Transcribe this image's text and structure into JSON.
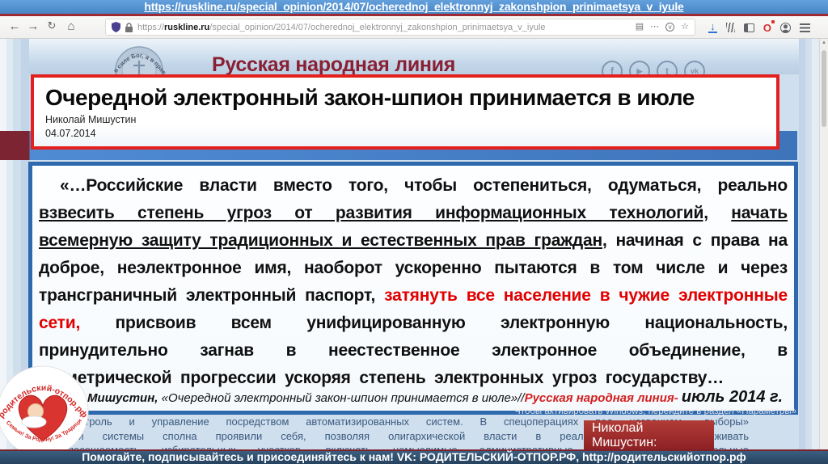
{
  "slide": {
    "source_url": "https://ruskline.ru/special_opinion/2014/07/ocherednoj_elektronnyj_zakonshpion_prinimaetsya_v_iyule"
  },
  "browser": {
    "left_icons": [
      {
        "name": "back-icon",
        "glyph": "←"
      },
      {
        "name": "forward-icon",
        "glyph": "→"
      },
      {
        "name": "reload-icon",
        "glyph": "↻"
      },
      {
        "name": "home-icon",
        "glyph": "⌂"
      }
    ],
    "address": {
      "scheme": "https://",
      "domain": "ruskline.ru",
      "path": "/special_opinion/2014/07/ocherednoj_elektronnyj_zakonshpion_prinimaetsya_v_iyule"
    },
    "urlbar_icons": [
      {
        "name": "reader-mode-icon",
        "glyph": "▤"
      },
      {
        "name": "page-actions-icon",
        "glyph": "⋯"
      },
      {
        "name": "pocket-icon",
        "glyph": "v"
      },
      {
        "name": "bookmark-star-icon",
        "glyph": "☆"
      }
    ],
    "right_icons": [
      {
        "name": "download-icon",
        "glyph": "↓"
      },
      {
        "name": "library-icon",
        "glyph": ""
      },
      {
        "name": "sidebar-icon",
        "glyph": ""
      },
      {
        "name": "adblock-icon",
        "glyph": "O"
      },
      {
        "name": "account-icon",
        "glyph": ""
      },
      {
        "name": "menu-icon",
        "glyph": ""
      }
    ]
  },
  "site": {
    "title": "Русская народная линия",
    "seal_motto": "Не в силе Бог, а в правде",
    "social_icons": [
      {
        "name": "facebook-icon",
        "glyph": "f",
        "small": false
      },
      {
        "name": "youtube-icon",
        "glyph": "▶",
        "small": true
      },
      {
        "name": "twitter-icon",
        "glyph": "t",
        "small": false
      },
      {
        "name": "vk-icon",
        "glyph": "vk",
        "small": true
      }
    ]
  },
  "article": {
    "title": "Очередной электронный закон-шпион принимается в июле",
    "author": "Николай Мишустин",
    "date": "04.07.2014"
  },
  "quote": {
    "segments": [
      {
        "text": "«…Российские власти вместо того, чтобы остепениться, одуматься, реально ",
        "style": ""
      },
      {
        "text": "взвесить степень угроз от развития информационных технологий,",
        "style": "u"
      },
      {
        "text": " ",
        "style": ""
      },
      {
        "text": "начать всемерную защиту традиционных и естественных прав граждан",
        "style": "u"
      },
      {
        "text": ", начиная с права на доброе, неэлектронное имя, наоборот ускоренно пытаются в том числе и через трансграничный электронный паспорт, ",
        "style": ""
      },
      {
        "text": "затянуть все население в чужие электронные сети,",
        "style": "red"
      },
      {
        "text": " присвоив всем унифицированную электронную национальность, принудительно загнав в неестественное электронное объединение, в геометрической прогрессии ускоряя степень электронных угроз государству…",
        "style": ""
      }
    ],
    "attribution": [
      {
        "text": "Николай Мишустин, ",
        "style": "bold"
      },
      {
        "text": "«Очередной электронный закон-шпион принимается в июле»//",
        "style": ""
      },
      {
        "text": "Русская народная линия- ",
        "style": "red"
      },
      {
        "text": "июль 2014 г.",
        "style": "big"
      }
    ]
  },
  "page": {
    "body_lines": [
      "контроль и управление посредством автоматизированных систем. В спецоперациях под названием «выборы»",
      "эти системы сполна проявили себя, позволяя олигархической власти в реальном времени отслеживать",
      "посещаемость избирательных участков, включать немыслимые административные ресурсы и карусельные"
    ]
  },
  "watermark": "Чтобы активировать Windows, перейдите в раздел «Параметры»",
  "speaker_box": {
    "line1": "Николай",
    "line2": "Мишустин:"
  },
  "footer": {
    "text": "Помогайте, подписывайтесь и присоединяйтесь к нам! VK: РОДИТЕЛЬСКИЙ-ОТПОР.РФ, http://родительскийотпор.рф"
  },
  "logo_badge": {
    "top_text": "родительский-отпор.рф",
    "bottom_text": "За Семью! За Родину! За Традиции!"
  },
  "scrollbar": {
    "up_glyph": "▴"
  },
  "colors": {
    "topbar_blue": "#4886c6",
    "accent_red": "#e3201d",
    "band_blue": "#4f8bd3",
    "band_maroon": "#7d2433",
    "quote_border_blue": "#2e68ad",
    "highlight_red": "#e20000",
    "site_title_maroon": "#8a2034",
    "speaker_box_red": "#8e2124",
    "footer_navy": "#2c4b66"
  }
}
